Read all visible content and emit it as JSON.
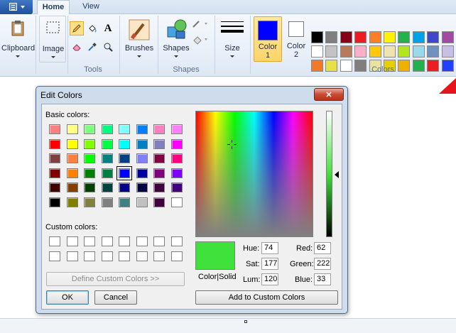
{
  "ribbon": {
    "tabs": [
      {
        "label": "Home"
      },
      {
        "label": "View"
      }
    ],
    "groups": {
      "clipboard": {
        "label": "Clipboard"
      },
      "image": {
        "label": "Image"
      },
      "tools": {
        "label": "Tools"
      },
      "brushes": {
        "label": "Brushes"
      },
      "shapes": {
        "label": "Shapes",
        "group_label": "Shapes"
      },
      "size": {
        "label": "Size"
      },
      "color1": {
        "label_a": "Color",
        "label_b": "1",
        "value": "#0000ff"
      },
      "color2": {
        "label_a": "Color",
        "label_b": "2",
        "value": "#ffffff"
      },
      "colors": {
        "label": "Colors"
      }
    },
    "palette": [
      [
        "#000000",
        "#7f7f7f",
        "#880015",
        "#ed1c24",
        "#ff7f27",
        "#fff200",
        "#22b14c",
        "#00a2e8",
        "#3f48cc",
        "#a349a4"
      ],
      [
        "#ffffff",
        "#c3c3c3",
        "#b97a57",
        "#ffaec9",
        "#ffc90e",
        "#efe4b0",
        "#b5e61d",
        "#99d9ea",
        "#7092be",
        "#c8bfe7"
      ],
      [
        "#f07a28",
        "#e8e046",
        "#ffffff",
        "#7f7f7f",
        "#e8e4a0",
        "#e8d000",
        "#f0b000",
        "#22b14c",
        "#ed1c24",
        "#2040ff"
      ]
    ]
  },
  "dialog": {
    "title": "Edit Colors",
    "close_glyph": "✕",
    "basic_colors_label": "Basic colors:",
    "basic_colors": [
      [
        "#ff8080",
        "#ffff80",
        "#80ff80",
        "#00ff80",
        "#80ffff",
        "#0080ff",
        "#ff80c0",
        "#ff80ff"
      ],
      [
        "#ff0000",
        "#ffff00",
        "#80ff00",
        "#00ff40",
        "#00ffff",
        "#0080c0",
        "#8080c0",
        "#ff00ff"
      ],
      [
        "#804040",
        "#ff8040",
        "#00ff00",
        "#008080",
        "#004080",
        "#8080ff",
        "#800040",
        "#ff0080"
      ],
      [
        "#800000",
        "#ff8000",
        "#008000",
        "#008040",
        "#0000ff",
        "#0000a0",
        "#800080",
        "#8000ff"
      ],
      [
        "#400000",
        "#804000",
        "#004000",
        "#004040",
        "#000080",
        "#000040",
        "#400040",
        "#400080"
      ],
      [
        "#000000",
        "#808000",
        "#808040",
        "#808080",
        "#408080",
        "#c0c0c0",
        "#400040",
        "#ffffff"
      ]
    ],
    "selected_basic": {
      "row": 3,
      "col": 4
    },
    "custom_colors_label": "Custom colors:",
    "define_custom_label": "Define Custom Colors >>",
    "ok_label": "OK",
    "cancel_label": "Cancel",
    "color_solid_label": "Color|Solid",
    "preview_color": "#3ee23a",
    "add_custom_label": "Add to Custom Colors",
    "hsl": {
      "hue_label": "Hue:",
      "hue": "74",
      "sat_label": "Sat:",
      "sat": "177",
      "lum_label": "Lum:",
      "lum": "120"
    },
    "rgb": {
      "red_label": "Red:",
      "red": "62",
      "green_label": "Green:",
      "green": "222",
      "blue_label": "Blue:",
      "blue": "33"
    }
  }
}
